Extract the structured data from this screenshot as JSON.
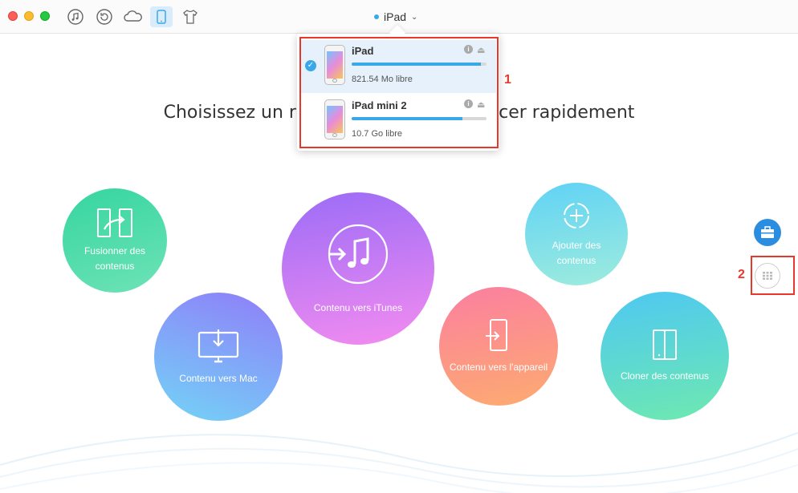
{
  "window": {
    "controls": [
      "close",
      "minimize",
      "zoom"
    ]
  },
  "toolbar": {
    "icons": [
      "itunes-icon",
      "restore-icon",
      "icloud-icon",
      "device-icon",
      "tshirt-icon"
    ],
    "active": "device-icon",
    "device_title": "iPad",
    "accent": "#3aa8e8"
  },
  "dropdown": {
    "devices": [
      {
        "name": "iPad",
        "free": "821.54 Mo libre",
        "selected": true,
        "used_fraction": 0.96
      },
      {
        "name": "iPad mini 2",
        "free": "10.7 Go libre",
        "selected": false,
        "used_fraction": 0.82
      }
    ]
  },
  "annotations": {
    "mark1": "1",
    "mark2": "2",
    "color": "#e8372b"
  },
  "headline": "Choisissez un raccourci pour commencer rapidement",
  "shortcuts": {
    "merge": {
      "label_line1": "Fusionner des",
      "label_line2": "contenus"
    },
    "mac": {
      "label": "Contenu vers Mac"
    },
    "itunes": {
      "label": "Contenu vers iTunes"
    },
    "add": {
      "label_line1": "Ajouter des",
      "label_line2": "contenus"
    },
    "device": {
      "label": "Contenu vers l'appareil"
    },
    "clone": {
      "label": "Cloner des contenus"
    }
  },
  "side": {
    "icons": [
      "toolbox-icon",
      "grid-icon"
    ]
  }
}
